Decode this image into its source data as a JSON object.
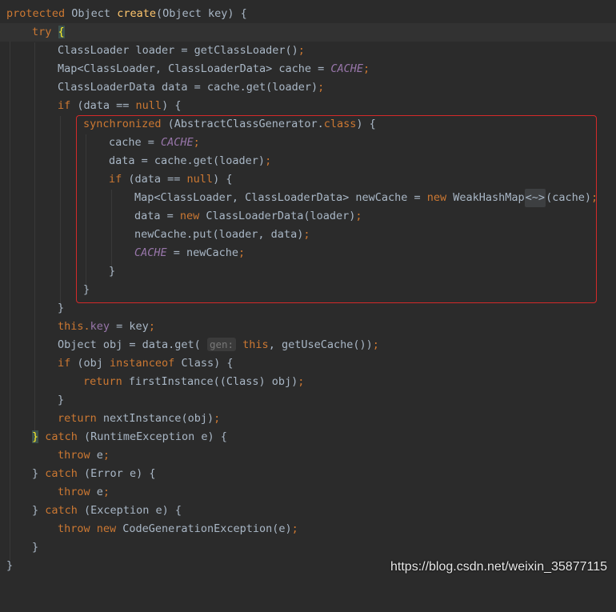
{
  "code": {
    "l01": {
      "a": "protected ",
      "b": "Object ",
      "c": "create",
      "d": "(Object key) {"
    },
    "l02": {
      "a": "try ",
      "b": "{"
    },
    "l03": {
      "a": "ClassLoader loader = getClassLoader()",
      "b": ";"
    },
    "l04": {
      "a": "Map<ClassLoader, ClassLoaderData> cache = ",
      "b": "CACHE",
      "c": ";"
    },
    "l05": {
      "a": "ClassLoaderData data = cache.get(loader)",
      "b": ";"
    },
    "l06": {
      "a": "if ",
      "b": "(data == ",
      "c": "null",
      "d": ") {"
    },
    "l07": {
      "a": "synchronized ",
      "b": "(AbstractClassGenerator.",
      "c": "class",
      "d": ") {"
    },
    "l08": {
      "a": "cache = ",
      "b": "CACHE",
      "c": ";"
    },
    "l09": {
      "a": "data = cache.get(loader)",
      "b": ";"
    },
    "l10": {
      "a": "if ",
      "b": "(data == ",
      "c": "null",
      "d": ") {"
    },
    "l11": {
      "a": "Map<ClassLoader, ClassLoaderData> newCache = ",
      "b": "new ",
      "c": "WeakHashMap",
      "d": "<~>",
      "e": "(cache)",
      "f": ";"
    },
    "l12": {
      "a": "data = ",
      "b": "new ",
      "c": "ClassLoaderData(loader)",
      "d": ";"
    },
    "l13": {
      "a": "newCache.put(loader, data)",
      "b": ";"
    },
    "l14": {
      "a": "CACHE",
      "b": " = newCache",
      "c": ";"
    },
    "l15": {
      "a": "}"
    },
    "l16": {
      "a": "}"
    },
    "l17": {
      "a": "}"
    },
    "l18": {
      "a": "this",
      "b": ".",
      "c": "key",
      "d": " = key",
      "e": ";"
    },
    "l19": {
      "a": "Object obj = data.get( ",
      "b": "gen:",
      "c": " this",
      "d": ", getUseCache())",
      "e": ";"
    },
    "l20": {
      "a": "if ",
      "b": "(obj ",
      "c": "instanceof ",
      "d": "Class) {"
    },
    "l21": {
      "a": "return ",
      "b": "firstInstance((Class) obj)",
      "c": ";"
    },
    "l22": {
      "a": "}"
    },
    "l23": {
      "a": "return ",
      "b": "nextInstance(obj)",
      "c": ";"
    },
    "l24": {
      "a": "}",
      "b": " catch ",
      "c": "(RuntimeException e) {"
    },
    "l25": {
      "a": "throw ",
      "b": "e",
      "c": ";"
    },
    "l26": {
      "a": "} ",
      "b": "catch ",
      "c": "(Error e) {"
    },
    "l27": {
      "a": "throw ",
      "b": "e",
      "c": ";"
    },
    "l28": {
      "a": "} ",
      "b": "catch ",
      "c": "(Exception e) {"
    },
    "l29": {
      "a": "throw new ",
      "b": "CodeGenerationException(e)",
      "c": ";"
    },
    "l30": {
      "a": "}"
    },
    "l31": {
      "a": "}"
    }
  },
  "watermark": "https://blog.csdn.net/weixin_35877115",
  "colors": {
    "background": "#2b2b2b",
    "keyword": "#cc7832",
    "method": "#ffc66d",
    "static_field": "#9876aa",
    "text": "#a9b7c6",
    "highlight_box": "#d42a2a"
  }
}
